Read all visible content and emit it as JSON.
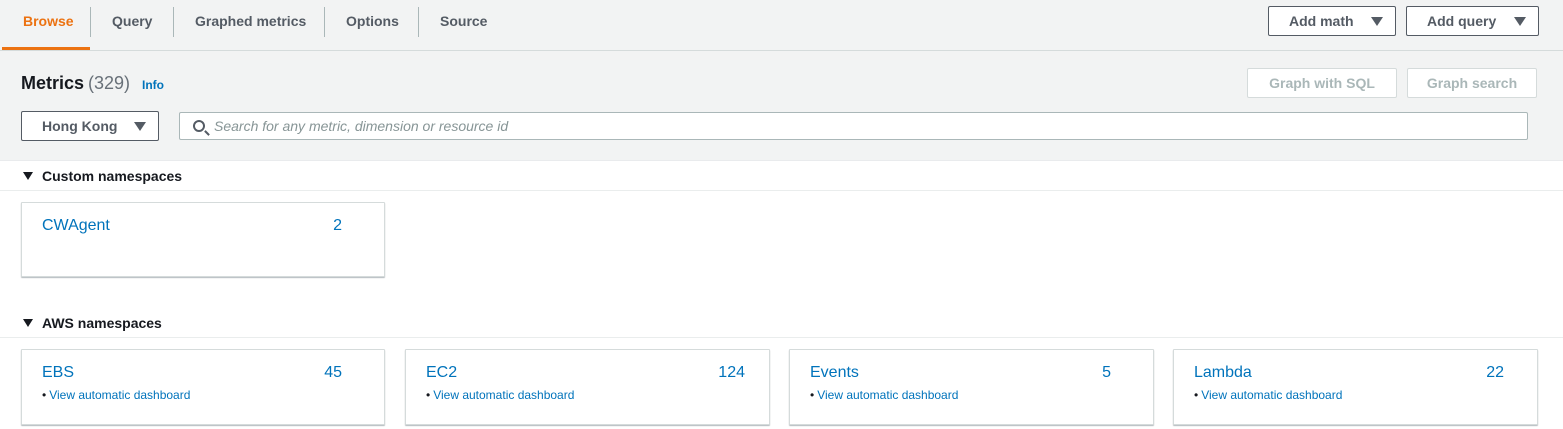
{
  "tabs": [
    {
      "label": "Browse",
      "active": true
    },
    {
      "label": "Query",
      "active": false
    },
    {
      "label": "Graphed metrics",
      "active": false
    },
    {
      "label": "Options",
      "active": false
    },
    {
      "label": "Source",
      "active": false
    }
  ],
  "toolbar": {
    "add_math_label": "Add math",
    "add_query_label": "Add query",
    "graph_sql_label": "Graph with SQL",
    "graph_search_label": "Graph search"
  },
  "metrics": {
    "title": "Metrics",
    "count": "(329)",
    "info_label": "Info"
  },
  "region": {
    "selected": "Hong Kong"
  },
  "search": {
    "placeholder": "Search for any metric, dimension or resource id",
    "value": ""
  },
  "custom_namespaces": {
    "title": "Custom namespaces",
    "items": [
      {
        "name": "CWAgent",
        "count": "2"
      }
    ]
  },
  "aws_namespaces": {
    "title": "AWS namespaces",
    "items": [
      {
        "name": "EBS",
        "count": "45",
        "dashboard_label": "View automatic dashboard"
      },
      {
        "name": "EC2",
        "count": "124",
        "dashboard_label": "View automatic dashboard"
      },
      {
        "name": "Events",
        "count": "5",
        "dashboard_label": "View automatic dashboard"
      },
      {
        "name": "Lambda",
        "count": "22",
        "dashboard_label": "View automatic dashboard"
      }
    ]
  },
  "colors": {
    "accent": "#ec7211",
    "link": "#0073bb",
    "text": "#16191f"
  }
}
